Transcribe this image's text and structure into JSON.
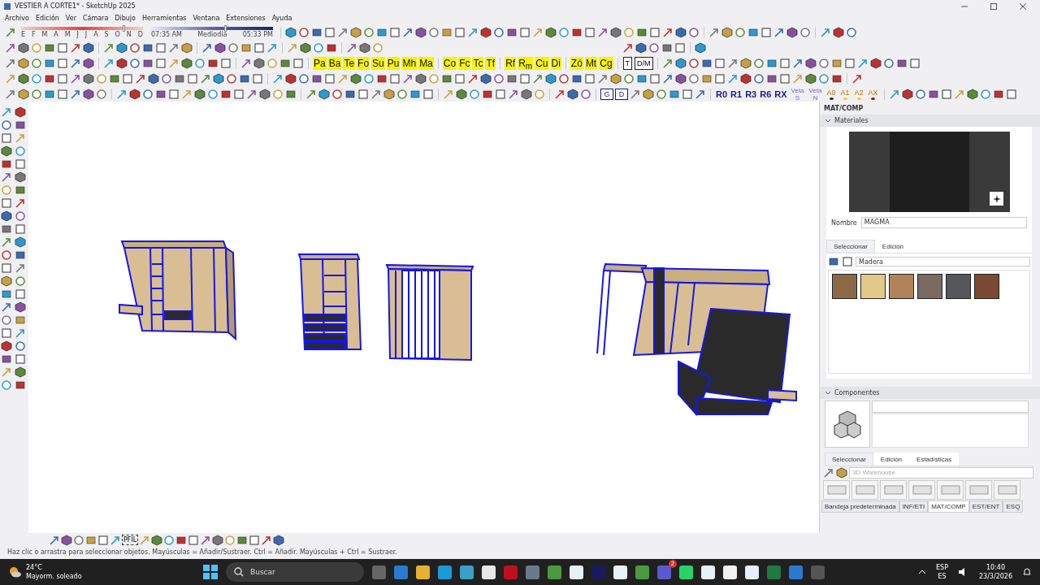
{
  "window": {
    "title": "VESTIER A CORTE1* - SketchUp 2025"
  },
  "menu": [
    "Archivo",
    "Edición",
    "Ver",
    "Cámara",
    "Dibujo",
    "Herramientas",
    "Ventana",
    "Extensiones",
    "Ayuda"
  ],
  "shadows": {
    "months": [
      "E",
      "F",
      "M",
      "A",
      "M",
      "J",
      "J",
      "A",
      "S",
      "O",
      "N",
      "D"
    ],
    "date_slider": {
      "level": 0.83
    },
    "time_start": "07:35 AM",
    "time_mid": "Mediodía",
    "time_end": "05:33 PM",
    "time_slider": {
      "level": 0.6
    }
  },
  "text_tool_groups": [
    [
      "Pa",
      "Ba",
      "Te",
      "Fo",
      "Su",
      "Pu",
      "Mh",
      "Ma"
    ],
    [
      "Co",
      "Fc",
      "Tc",
      "Tf"
    ],
    [
      "Rf",
      "R$_{m}$",
      "Cu",
      "Di"
    ],
    [
      "Zó",
      "Mt",
      "Cg"
    ]
  ],
  "box_tools": [
    "T",
    "D/M"
  ],
  "tag_buttons": [
    "G",
    "D"
  ],
  "layers": [
    "R0",
    "R1",
    "R3",
    "R6",
    "RX"
  ],
  "veta": [
    {
      "top": "Veta",
      "bottom": "S"
    },
    {
      "top": "Veta",
      "bottom": "N"
    }
  ],
  "heights": [
    {
      "label": "A0",
      "color": "#222222"
    },
    {
      "label": "A1",
      "color": "#f0d000"
    },
    {
      "label": "A2",
      "color": "#f0d000"
    },
    {
      "label": "AX",
      "color": "#c00000"
    }
  ],
  "bottom_toolbar": {
    "label": "PFIL"
  },
  "status_bar": "Haz clic o arrastra para seleccionar objetos. Mayúsculas = Añadir/Sustraer. Ctrl = Añadir. Mayúsculas + Ctrl = Sustraer.",
  "panel": {
    "title": "MAT/COMP",
    "materials": {
      "header": "Materiales",
      "name_label": "Nombre",
      "name": "MAGMA",
      "tabs": [
        {
          "label": "Seleccionar",
          "selected": true
        },
        {
          "label": "Edición",
          "selected": false
        }
      ],
      "library": "Madera",
      "swatches": [
        {
          "color": "#8a6a45"
        },
        {
          "color": "#e2c98a"
        },
        {
          "color": "#b08458"
        },
        {
          "color": "#7b6a62"
        },
        {
          "color": "#55575a"
        },
        {
          "color": "#7a4a35"
        }
      ]
    },
    "components": {
      "header": "Componentes",
      "tabs": [
        {
          "label": "Seleccionar",
          "selected": true
        },
        {
          "label": "Edición",
          "selected": false
        },
        {
          "label": "Estadísticas",
          "selected": false
        }
      ],
      "search_placeholder": "3D Warehouse"
    },
    "tray_tabs": [
      {
        "label": "Bandeja predeterminada",
        "selected": false
      },
      {
        "label": "INF/ETI",
        "selected": false
      },
      {
        "label": "MAT/COMP",
        "selected": true
      },
      {
        "label": "EST/ENT",
        "selected": false
      },
      {
        "label": "ESQ",
        "selected": false
      }
    ]
  },
  "taskbar": {
    "temperature": "24°C",
    "weather": "Mayorm. soleado",
    "search_placeholder": "Buscar",
    "badge": "2",
    "language": "ESP",
    "layout": "ES",
    "time": "10:40",
    "date": "23/3/2026"
  }
}
